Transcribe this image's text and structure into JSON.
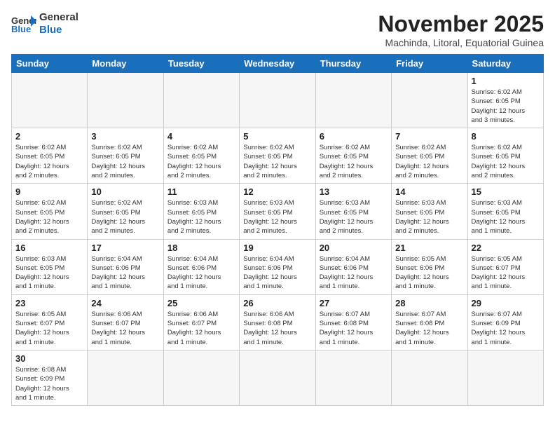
{
  "logo": {
    "text_general": "General",
    "text_blue": "Blue"
  },
  "title": "November 2025",
  "subtitle": "Machinda, Litoral, Equatorial Guinea",
  "headers": [
    "Sunday",
    "Monday",
    "Tuesday",
    "Wednesday",
    "Thursday",
    "Friday",
    "Saturday"
  ],
  "weeks": [
    [
      {
        "day": "",
        "empty": true
      },
      {
        "day": "",
        "empty": true
      },
      {
        "day": "",
        "empty": true
      },
      {
        "day": "",
        "empty": true
      },
      {
        "day": "",
        "empty": true
      },
      {
        "day": "",
        "empty": true
      },
      {
        "day": "1",
        "info": "Sunrise: 6:02 AM\nSunset: 6:05 PM\nDaylight: 12 hours\nand 3 minutes."
      }
    ],
    [
      {
        "day": "2",
        "info": "Sunrise: 6:02 AM\nSunset: 6:05 PM\nDaylight: 12 hours\nand 2 minutes."
      },
      {
        "day": "3",
        "info": "Sunrise: 6:02 AM\nSunset: 6:05 PM\nDaylight: 12 hours\nand 2 minutes."
      },
      {
        "day": "4",
        "info": "Sunrise: 6:02 AM\nSunset: 6:05 PM\nDaylight: 12 hours\nand 2 minutes."
      },
      {
        "day": "5",
        "info": "Sunrise: 6:02 AM\nSunset: 6:05 PM\nDaylight: 12 hours\nand 2 minutes."
      },
      {
        "day": "6",
        "info": "Sunrise: 6:02 AM\nSunset: 6:05 PM\nDaylight: 12 hours\nand 2 minutes."
      },
      {
        "day": "7",
        "info": "Sunrise: 6:02 AM\nSunset: 6:05 PM\nDaylight: 12 hours\nand 2 minutes."
      },
      {
        "day": "8",
        "info": "Sunrise: 6:02 AM\nSunset: 6:05 PM\nDaylight: 12 hours\nand 2 minutes."
      }
    ],
    [
      {
        "day": "9",
        "info": "Sunrise: 6:02 AM\nSunset: 6:05 PM\nDaylight: 12 hours\nand 2 minutes."
      },
      {
        "day": "10",
        "info": "Sunrise: 6:02 AM\nSunset: 6:05 PM\nDaylight: 12 hours\nand 2 minutes."
      },
      {
        "day": "11",
        "info": "Sunrise: 6:03 AM\nSunset: 6:05 PM\nDaylight: 12 hours\nand 2 minutes."
      },
      {
        "day": "12",
        "info": "Sunrise: 6:03 AM\nSunset: 6:05 PM\nDaylight: 12 hours\nand 2 minutes."
      },
      {
        "day": "13",
        "info": "Sunrise: 6:03 AM\nSunset: 6:05 PM\nDaylight: 12 hours\nand 2 minutes."
      },
      {
        "day": "14",
        "info": "Sunrise: 6:03 AM\nSunset: 6:05 PM\nDaylight: 12 hours\nand 2 minutes."
      },
      {
        "day": "15",
        "info": "Sunrise: 6:03 AM\nSunset: 6:05 PM\nDaylight: 12 hours\nand 1 minute."
      }
    ],
    [
      {
        "day": "16",
        "info": "Sunrise: 6:03 AM\nSunset: 6:05 PM\nDaylight: 12 hours\nand 1 minute."
      },
      {
        "day": "17",
        "info": "Sunrise: 6:04 AM\nSunset: 6:06 PM\nDaylight: 12 hours\nand 1 minute."
      },
      {
        "day": "18",
        "info": "Sunrise: 6:04 AM\nSunset: 6:06 PM\nDaylight: 12 hours\nand 1 minute."
      },
      {
        "day": "19",
        "info": "Sunrise: 6:04 AM\nSunset: 6:06 PM\nDaylight: 12 hours\nand 1 minute."
      },
      {
        "day": "20",
        "info": "Sunrise: 6:04 AM\nSunset: 6:06 PM\nDaylight: 12 hours\nand 1 minute."
      },
      {
        "day": "21",
        "info": "Sunrise: 6:05 AM\nSunset: 6:06 PM\nDaylight: 12 hours\nand 1 minute."
      },
      {
        "day": "22",
        "info": "Sunrise: 6:05 AM\nSunset: 6:07 PM\nDaylight: 12 hours\nand 1 minute."
      }
    ],
    [
      {
        "day": "23",
        "info": "Sunrise: 6:05 AM\nSunset: 6:07 PM\nDaylight: 12 hours\nand 1 minute."
      },
      {
        "day": "24",
        "info": "Sunrise: 6:06 AM\nSunset: 6:07 PM\nDaylight: 12 hours\nand 1 minute."
      },
      {
        "day": "25",
        "info": "Sunrise: 6:06 AM\nSunset: 6:07 PM\nDaylight: 12 hours\nand 1 minute."
      },
      {
        "day": "26",
        "info": "Sunrise: 6:06 AM\nSunset: 6:08 PM\nDaylight: 12 hours\nand 1 minute."
      },
      {
        "day": "27",
        "info": "Sunrise: 6:07 AM\nSunset: 6:08 PM\nDaylight: 12 hours\nand 1 minute."
      },
      {
        "day": "28",
        "info": "Sunrise: 6:07 AM\nSunset: 6:08 PM\nDaylight: 12 hours\nand 1 minute."
      },
      {
        "day": "29",
        "info": "Sunrise: 6:07 AM\nSunset: 6:09 PM\nDaylight: 12 hours\nand 1 minute."
      }
    ],
    [
      {
        "day": "30",
        "info": "Sunrise: 6:08 AM\nSunset: 6:09 PM\nDaylight: 12 hours\nand 1 minute."
      },
      {
        "day": "",
        "empty": true
      },
      {
        "day": "",
        "empty": true
      },
      {
        "day": "",
        "empty": true
      },
      {
        "day": "",
        "empty": true
      },
      {
        "day": "",
        "empty": true
      },
      {
        "day": "",
        "empty": true
      }
    ]
  ]
}
